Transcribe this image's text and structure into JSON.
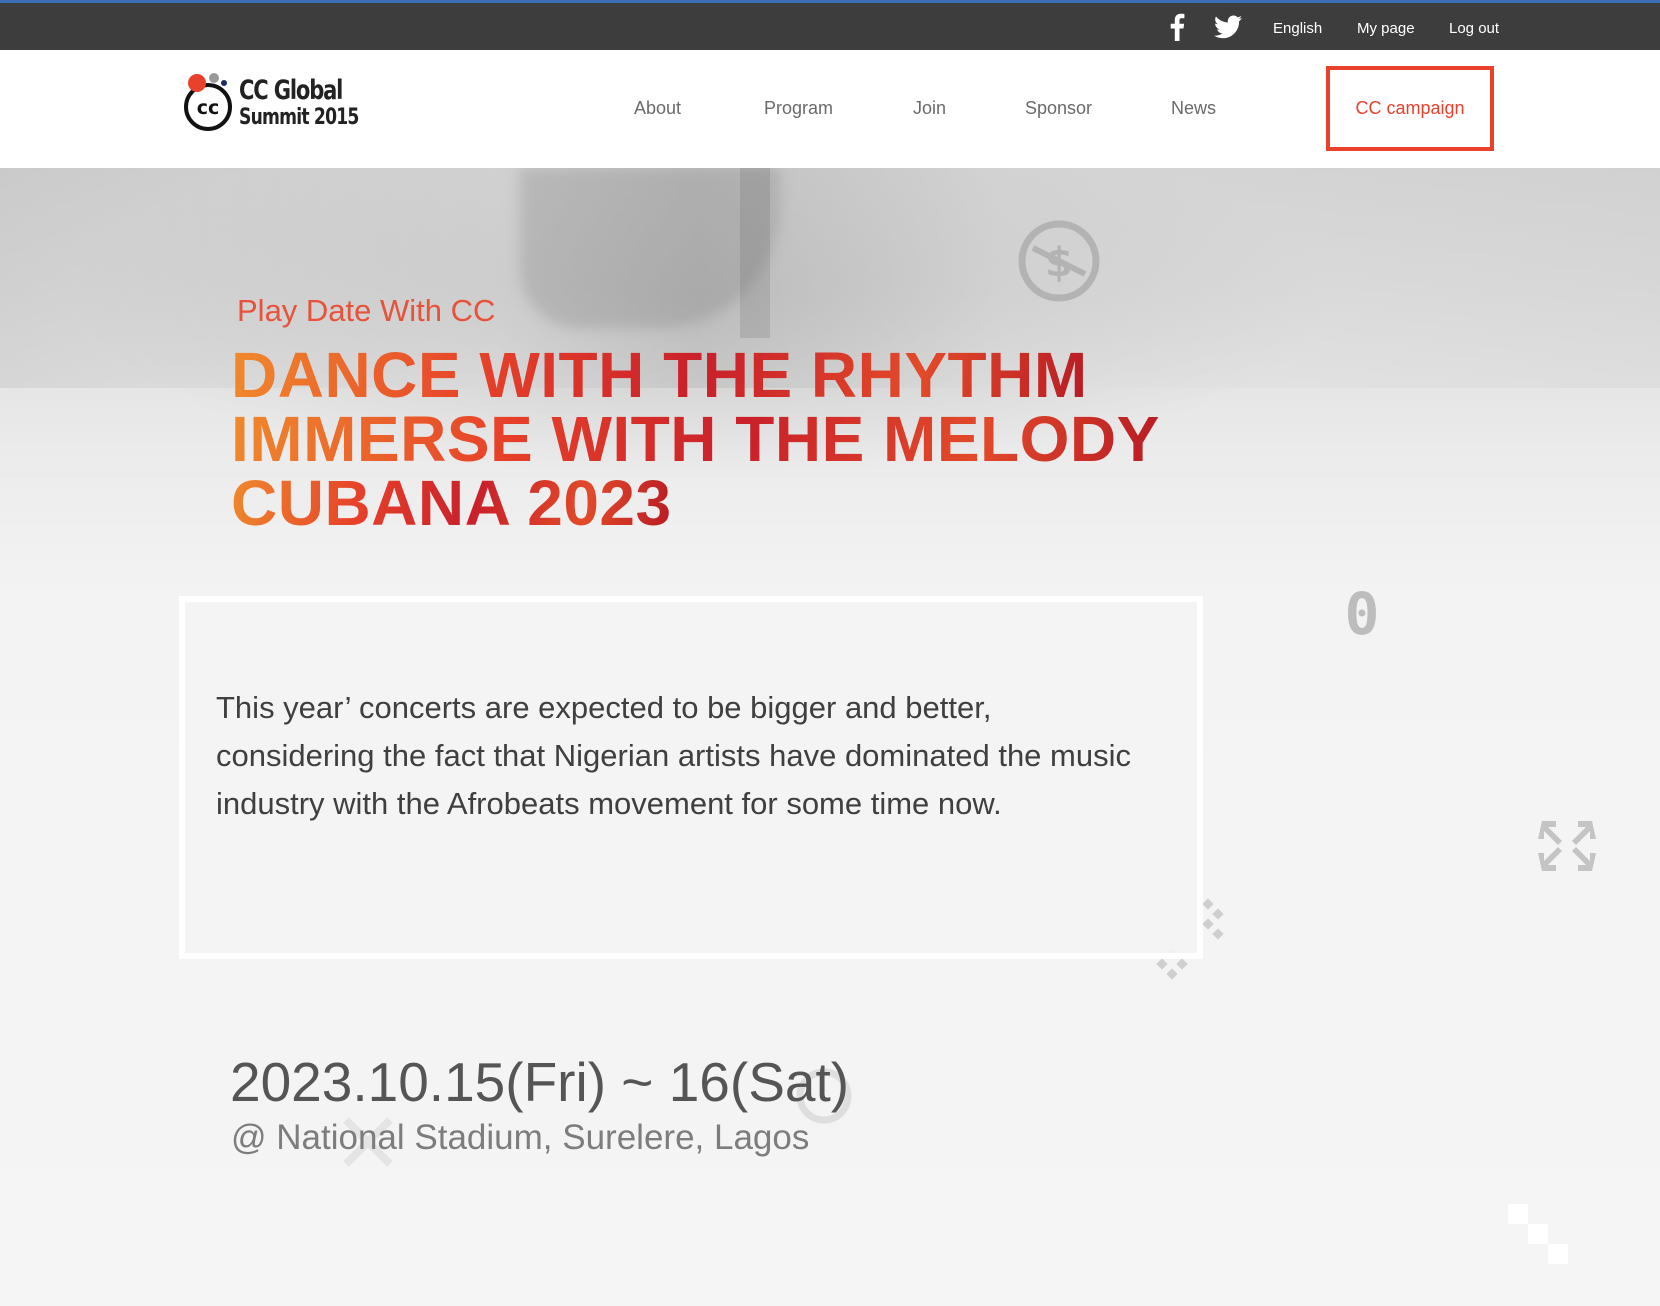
{
  "topbar": {
    "social": [
      "facebook-icon",
      "twitter-icon"
    ],
    "language": "English",
    "my_page": "My page",
    "log_out": "Log out"
  },
  "header": {
    "logo": {
      "mark": "cc",
      "line1": "CC Global",
      "line2": "Summit 2015"
    },
    "nav": {
      "about": "About",
      "program": "Program",
      "join": "Join",
      "sponsor": "Sponsor",
      "news": "News",
      "campaign": "CC campaign"
    }
  },
  "hero": {
    "eyebrow": "Play Date With CC",
    "headline": [
      "DANCE WITH THE RHYTHM",
      "IMMERSE WITH THE MELODY",
      "CUBANA 2023"
    ],
    "description": "This year’ concerts are expected to be bigger and better, considering the fact that Nigerian artists have dominated the music industry with the Afrobeats movement for some time now.",
    "date": "2023.10.15(Fri) ~ 16(Sat)",
    "venue": "@ National Stadium, Surelere, Lagos",
    "decorations": [
      "no-commercial-icon",
      "zero-icon",
      "remix-arrows-icon",
      "pixel-icon"
    ]
  },
  "colors": {
    "topbar_bg": "#3d3d3d",
    "accent": "#e8412c",
    "nav_text": "#6a6a6a",
    "headline_gradient": [
      "#f08a2c",
      "#e6402a",
      "#c9202a",
      "#b81a24"
    ]
  }
}
